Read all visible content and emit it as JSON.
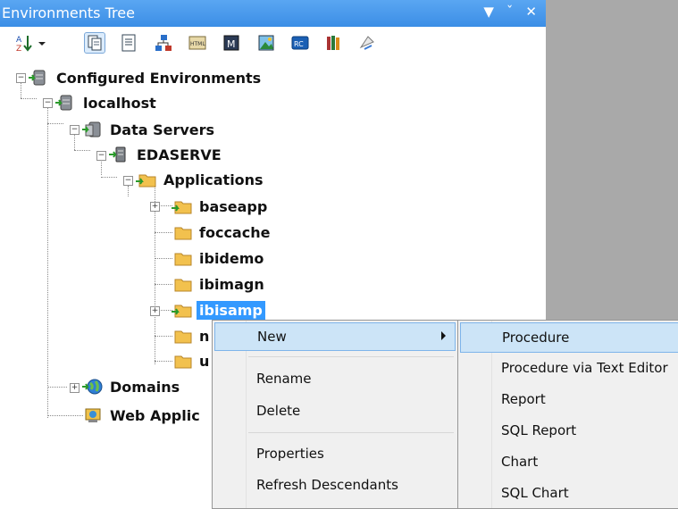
{
  "window": {
    "title": "Environments Tree",
    "buttons": [
      "▼",
      "ᵖ",
      "✕"
    ]
  },
  "toolbar": {
    "icons": [
      "sort-icon",
      "dropdown-arrow-icon",
      "copy-view-icon",
      "document-icon",
      "network-icon",
      "html-icon",
      "m-icon",
      "image-icon",
      "rc-icon",
      "books-icon",
      "wizard-icon"
    ]
  },
  "tree": {
    "root": "Configured Environments",
    "host": "localhost",
    "data_servers": "Data Servers",
    "server": "EDASERVE",
    "applications": "Applications",
    "apps": [
      "baseapp",
      "foccache",
      "ibidemo",
      "ibimagn",
      "ibisamp",
      "n",
      "u"
    ],
    "domains": "Domains",
    "web_applications": "Web Applic"
  },
  "context_menu": {
    "items": [
      "New",
      "Rename",
      "Delete",
      "Properties",
      "Refresh Descendants"
    ]
  },
  "submenu": {
    "items": [
      "Procedure",
      "Procedure via Text Editor",
      "Report",
      "SQL Report",
      "Chart",
      "SQL Chart"
    ]
  }
}
